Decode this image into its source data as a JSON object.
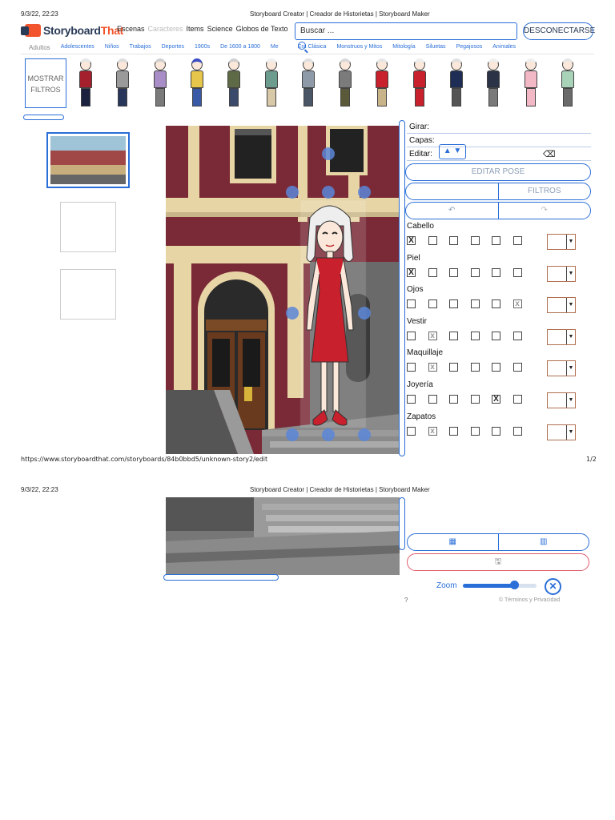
{
  "print": {
    "date": "9/3/22, 22:23",
    "title": "Storyboard Creator | Creador de Historietas | Storyboard Maker",
    "url": "https://www.storyboardthat.com/storyboards/84b0bbd5/unknown-story2/edit",
    "page": "1/2"
  },
  "brand": {
    "name_a": "Storyboard",
    "name_b": "That"
  },
  "topnav": {
    "items": [
      "Escenas",
      "Caracteres",
      "Items",
      "Science",
      "Globos de Texto"
    ],
    "search_placeholder": "Buscar ...",
    "disconnect": "DESCONECTARSE"
  },
  "categories": [
    "Adultos",
    "Adolescentes",
    "Niños",
    "Trabajos",
    "Deportes",
    "1900s",
    "De 1600 a 1800",
    "Me",
    "Era Clásica",
    "Monstruos y Mitos",
    "Mitología",
    "Siluetas",
    "Pegajosos",
    "Animales"
  ],
  "filters_button": [
    "MOSTRAR",
    "FILTROS"
  ],
  "characters": [
    {
      "shirt": "#a3202c",
      "pants": "#1b2240",
      "hair": "#e6e6e6"
    },
    {
      "shirt": "#9a9a9a",
      "pants": "#27365a",
      "hair": "#dcdcdc"
    },
    {
      "shirt": "#a88dc6",
      "pants": "#7a7a7a",
      "hair": "#cfcfcf"
    },
    {
      "shirt": "#e6c64b",
      "pants": "#3a5aa8",
      "hair": "#3a4dc2"
    },
    {
      "shirt": "#5e6a45",
      "pants": "#3b4a6a",
      "hair": "#cfcfcf"
    },
    {
      "shirt": "#6b9c8e",
      "pants": "#d7c8a8",
      "hair": "#eeeeee"
    },
    {
      "shirt": "#8f9aa8",
      "pants": "#4a5566",
      "hair": "#e0e0e0"
    },
    {
      "shirt": "#7b7b7b",
      "pants": "#5a5a3a",
      "hair": "#d8d8d8"
    },
    {
      "shirt": "#c8202c",
      "pants": "#c9b48a",
      "hair": "#e6e6e6"
    },
    {
      "shirt": "#c8202c",
      "pants": "#c8202c",
      "hair": "#eeeeee"
    },
    {
      "shirt": "#1e2d55",
      "pants": "#555555",
      "hair": "#e0e0e0"
    },
    {
      "shirt": "#2b3346",
      "pants": "#7a7a7a",
      "hair": "#eeeeee"
    },
    {
      "shirt": "#f2b8c6",
      "pants": "#f2b8c6",
      "hair": "#eeeeee"
    },
    {
      "shirt": "#a8d3b8",
      "pants": "#6a6a6a",
      "hair": "#e6e6e6"
    }
  ],
  "panel": {
    "rotate": "Girar:",
    "layers": "Capas:",
    "edit": "Editar:",
    "edit_pose": "EDITAR POSE",
    "filters": "FILTROS",
    "undo_icon": "undo-icon",
    "redo_icon": "redo-icon",
    "attributes": [
      {
        "label": "Cabello",
        "checks": [
          "X",
          "",
          "",
          "",
          "",
          ""
        ],
        "color": "#ffffff"
      },
      {
        "label": "Piel",
        "checks": [
          "X",
          "",
          "",
          "",
          "",
          ""
        ],
        "color": "#ffffff"
      },
      {
        "label": "Ojos",
        "checks": [
          "",
          "",
          "",
          "",
          "",
          "x"
        ],
        "color": "#ffffff"
      },
      {
        "label": "Vestir",
        "checks": [
          "",
          "x",
          "",
          "",
          "",
          ""
        ],
        "color": "#ffffff"
      },
      {
        "label": "Maquillaje",
        "checks": [
          "",
          "x",
          "",
          "",
          "",
          ""
        ],
        "color": "#ffffff"
      },
      {
        "label": "Joyería",
        "checks": [
          "",
          "",
          "",
          "",
          "X",
          ""
        ],
        "color": "#ffffff"
      },
      {
        "label": "Zapatos",
        "checks": [
          "",
          "x",
          "",
          "",
          "",
          ""
        ],
        "color": "#ffffff"
      }
    ]
  },
  "bottom": {
    "zoom_label": "Zoom",
    "zoom_level": 0.7,
    "help": "?",
    "terms": "© Términos y Privacidad",
    "grid_icon": "grid-icon",
    "layout_icon": "layout-icon",
    "save_icon": "save-icon"
  },
  "colors": {
    "accent": "#2a6ed8",
    "brand_orange": "#f2542d",
    "brand_navy": "#2a3b57",
    "dress": "#c8202c"
  }
}
